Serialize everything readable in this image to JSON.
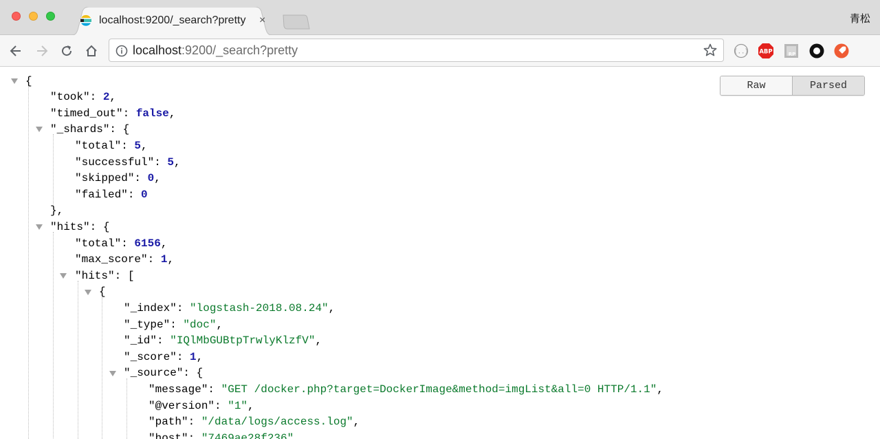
{
  "window": {
    "profile_name": "青松"
  },
  "tab": {
    "title": "localhost:9200/_search?pretty",
    "close_glyph": "×",
    "favicon": "elastic-icon"
  },
  "toolbar": {
    "back_icon": "back-arrow-icon",
    "forward_icon": "forward-arrow-icon",
    "reload_icon": "reload-icon",
    "home_icon": "home-icon",
    "url_host": "localhost",
    "url_path": ":9200/_search?pretty",
    "bookmark_icon": "star-icon",
    "extensions": [
      "json-formatter-icon",
      "adblock-plus-icon",
      "rp-extension-icon",
      "circle-extension-icon",
      "rocket-extension-icon"
    ],
    "abp_label": "ABP",
    "rp_label": "RP"
  },
  "viewer": {
    "raw_label": "Raw",
    "parsed_label": "Parsed",
    "active": "Parsed"
  },
  "json": {
    "l1": "{",
    "took_key": "\"took\"",
    "took_val": "2",
    "timed_out_key": "\"timed_out\"",
    "timed_out_val": "false",
    "shards_key": "\"_shards\"",
    "shards_open": "{",
    "total_key": "\"total\"",
    "total_val": "5",
    "successful_key": "\"successful\"",
    "successful_val": "5",
    "skipped_key": "\"skipped\"",
    "skipped_val": "0",
    "failed_key": "\"failed\"",
    "failed_val": "0",
    "shards_close": "},",
    "hits_key": "\"hits\"",
    "hits_open": "{",
    "hits_total_key": "\"total\"",
    "hits_total_val": "6156",
    "max_score_key": "\"max_score\"",
    "max_score_val": "1",
    "hits_arr_key": "\"hits\"",
    "hits_arr_open": "[",
    "hit_open": "{",
    "index_key": "\"_index\"",
    "index_val": "\"logstash-2018.08.24\"",
    "type_key": "\"_type\"",
    "type_val": "\"doc\"",
    "id_key": "\"_id\"",
    "id_val": "\"IQlMbGUBtpTrwlyKlzfV\"",
    "score_key": "\"_score\"",
    "score_val": "1",
    "source_key": "\"_source\"",
    "source_open": "{",
    "message_key": "\"message\"",
    "message_val": "\"GET /docker.php?target=DockerImage&method=imgList&all=0 HTTP/1.1\"",
    "version_key": "\"@version\"",
    "version_val": "\"1\"",
    "path_key": "\"path\"",
    "path_val": "\"/data/logs/access.log\"",
    "host_key": "\"host\"",
    "host_val": "\"7469ae28f236\""
  }
}
